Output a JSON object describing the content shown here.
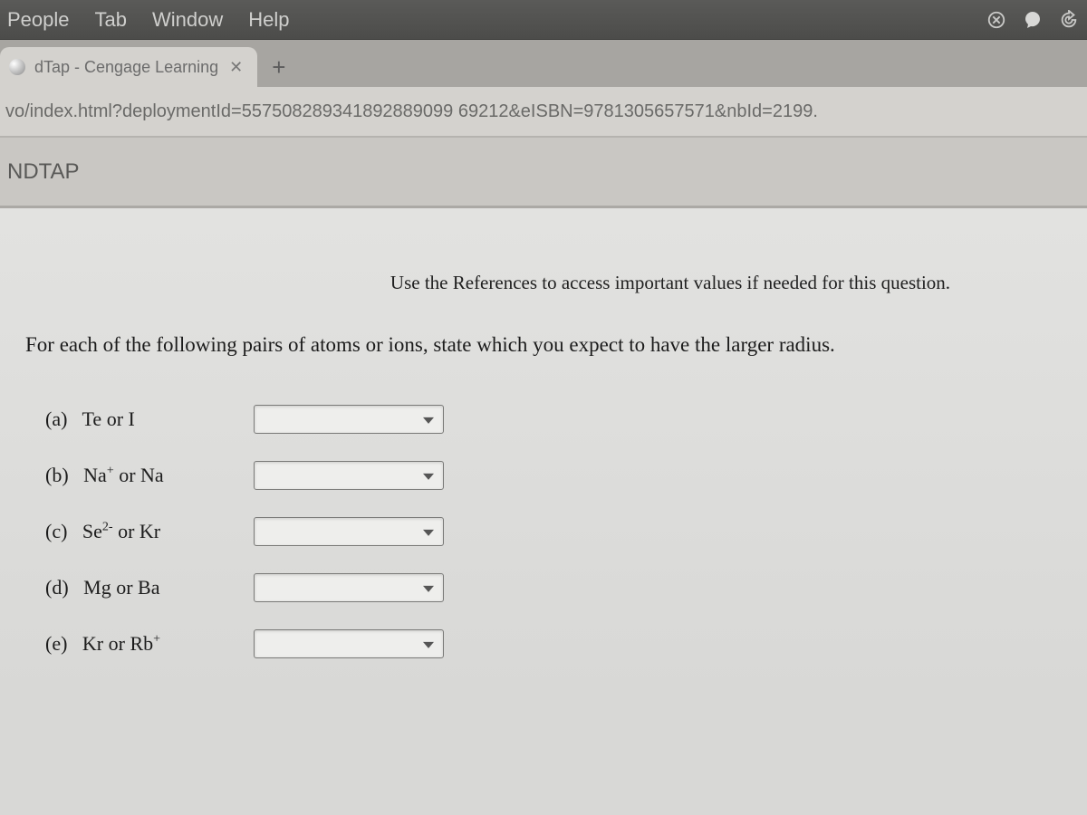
{
  "menubar": {
    "items": [
      "People",
      "Tab",
      "Window",
      "Help"
    ],
    "status_icons": [
      "sync-icon",
      "mail-icon",
      "refresh-icon"
    ]
  },
  "browser": {
    "tab_title": "dTap - Cengage Learning",
    "url": "vo/index.html?deploymentId=557508289341892889099 69212&eISBN=9781305657571&nbId=2199."
  },
  "page": {
    "header": "NDTAP",
    "references_note": "Use the References to access important values if needed for this question.",
    "prompt": "For each of the following pairs of atoms or ions, state which you expect to have the larger radius.",
    "questions": [
      {
        "letter": "(a)",
        "pair_html": "Te or I"
      },
      {
        "letter": "(b)",
        "pair_html": "Na<sup>+</sup> or Na"
      },
      {
        "letter": "(c)",
        "pair_html": "Se<sup>2-</sup> or Kr"
      },
      {
        "letter": "(d)",
        "pair_html": "Mg or Ba"
      },
      {
        "letter": "(e)",
        "pair_html": "Kr or Rb<sup>+</sup>"
      }
    ]
  }
}
